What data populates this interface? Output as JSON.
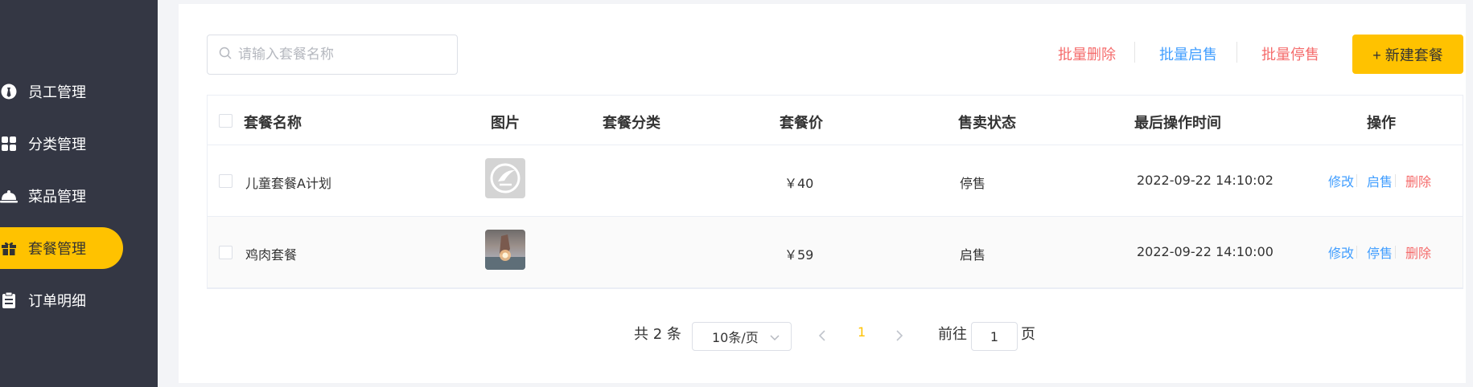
{
  "sidebar": {
    "items": [
      {
        "label": "员工管理",
        "icon": "employee-icon"
      },
      {
        "label": "分类管理",
        "icon": "category-icon"
      },
      {
        "label": "菜品管理",
        "icon": "dish-icon"
      },
      {
        "label": "套餐管理",
        "icon": "gift-icon",
        "active": true
      },
      {
        "label": "订单明细",
        "icon": "clipboard-icon"
      }
    ]
  },
  "toolbar": {
    "search_placeholder": "请输入套餐名称",
    "batch_delete": "批量删除",
    "batch_on_sale": "批量启售",
    "batch_off_sale": "批量停售",
    "new_setmeal": "+ 新建套餐"
  },
  "table": {
    "columns": [
      "套餐名称",
      "图片",
      "套餐分类",
      "套餐价",
      "售卖状态",
      "最后操作时间",
      "操作"
    ],
    "rows": [
      {
        "name": "儿童套餐A计划",
        "category": "",
        "price": "￥40",
        "status": "停售",
        "updated": "2022-09-22 14:10:02",
        "ops": [
          "修改",
          "启售",
          "删除"
        ]
      },
      {
        "name": "鸡肉套餐",
        "category": "",
        "price": "￥59",
        "status": "启售",
        "updated": "2022-09-22 14:10:00",
        "ops": [
          "修改",
          "停售",
          "删除"
        ]
      }
    ]
  },
  "pagination": {
    "total": "共 2 条",
    "page_size": "10条/页",
    "current_page": "1",
    "goto_prefix": "前往",
    "goto_value": "1",
    "goto_suffix": "页"
  },
  "colors": {
    "sidebar_bg": "#343744",
    "accent": "#ffc200",
    "link_blue": "#419eff",
    "danger_red": "#f56c6c"
  }
}
